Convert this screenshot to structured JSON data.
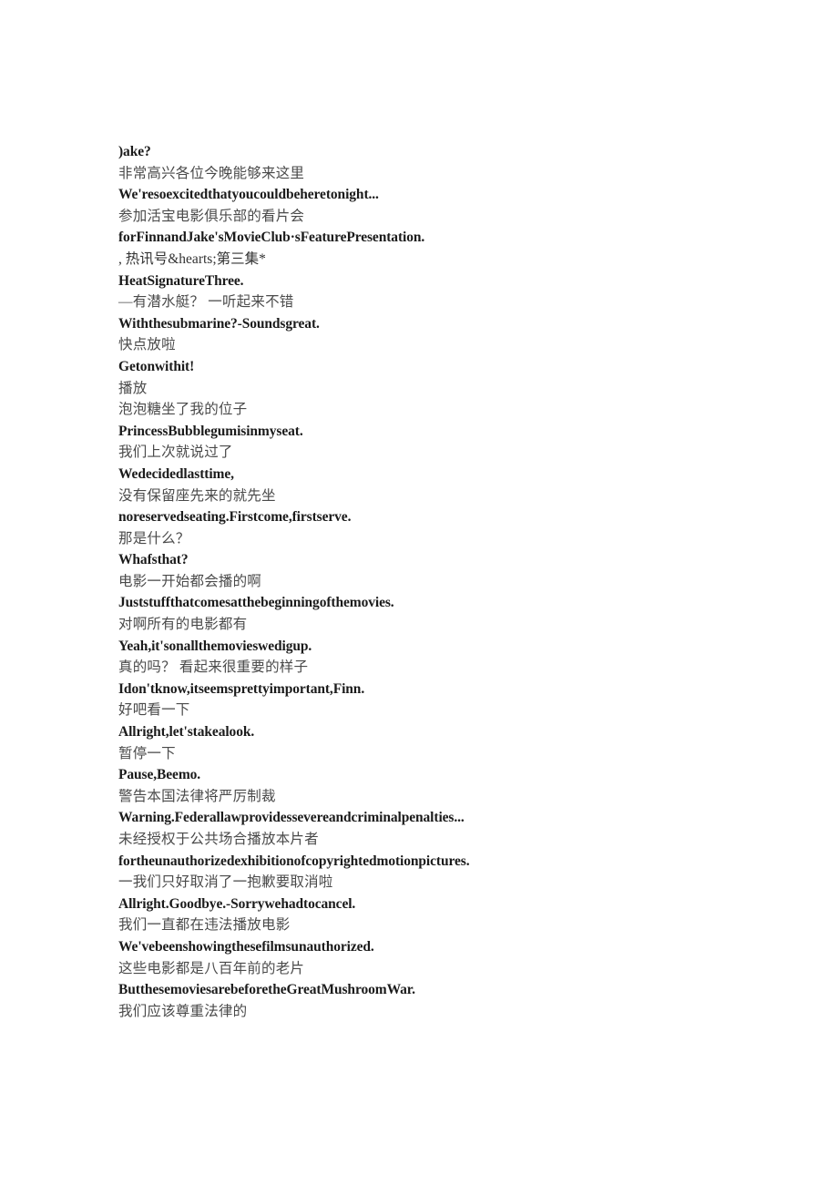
{
  "document": {
    "background_color": "#ffffff",
    "text_color_primary": "#1b1b1b",
    "text_color_secondary": "#4a4a4a",
    "lines": [
      {
        "text": ")ake?",
        "lang": "en"
      },
      {
        "text": "非常高兴各位今晚能够来这里",
        "lang": "zh"
      },
      {
        "text": "We'resoexcitedthatyoucouldbeheretonight...",
        "lang": "en"
      },
      {
        "text": "参加活宝电影俱乐部的看片会",
        "lang": "zh"
      },
      {
        "text": "forFinnandJake'sMovieClub·sFeaturePresentation.",
        "lang": "en"
      },
      {
        "text": ", 热讯号&hearts;第三集*",
        "lang": "mixed"
      },
      {
        "text": "HeatSignatureThree.",
        "lang": "en"
      },
      {
        "text": "—有潜水艇？ 一听起来不错",
        "lang": "zh"
      },
      {
        "text": "Withthesubmarine?-Soundsgreat.",
        "lang": "en"
      },
      {
        "text": "快点放啦",
        "lang": "zh"
      },
      {
        "text": "Getonwithit!",
        "lang": "en"
      },
      {
        "text": "播放",
        "lang": "zh"
      },
      {
        "text": "泡泡糖坐了我的位子",
        "lang": "zh"
      },
      {
        "text": "PrincessBubblegumisinmyseat.",
        "lang": "en"
      },
      {
        "text": "我们上次就说过了",
        "lang": "zh"
      },
      {
        "text": "Wedecidedlasttime,",
        "lang": "en"
      },
      {
        "text": "没有保留座先来的就先坐",
        "lang": "zh"
      },
      {
        "text": "noreservedseating.Firstcome,firstserve.",
        "lang": "en"
      },
      {
        "text": "那是什么？",
        "lang": "zh"
      },
      {
        "text": "Whafsthat?",
        "lang": "en"
      },
      {
        "text": "电影一开始都会播的啊",
        "lang": "zh"
      },
      {
        "text": "Juststuffthatcomesatthebeginningofthemovies.",
        "lang": "en"
      },
      {
        "text": "对啊所有的电影都有",
        "lang": "zh"
      },
      {
        "text": "Yeah,it'sonallthemovieswedigup.",
        "lang": "en"
      },
      {
        "text": "真的吗？ 看起来很重要的样子",
        "lang": "zh"
      },
      {
        "text": "Idon'tknow,itseemsprettyimportant,Finn.",
        "lang": "en"
      },
      {
        "text": "好吧看一下",
        "lang": "zh"
      },
      {
        "text": "Allright,let'stakealook.",
        "lang": "en"
      },
      {
        "text": "暂停一下",
        "lang": "zh"
      },
      {
        "text": "Pause,Beemo.",
        "lang": "en"
      },
      {
        "text": "警告本国法律将严厉制裁",
        "lang": "zh"
      },
      {
        "text": "Warning.Federallawprovidessevereandcriminalpenalties...",
        "lang": "en"
      },
      {
        "text": "未经授权于公共场合播放本片者",
        "lang": "zh"
      },
      {
        "text": "fortheunauthorizedexhibitionofcopyrightedmotionpictures.",
        "lang": "en"
      },
      {
        "text": "一我们只好取消了一抱歉要取消啦",
        "lang": "zh"
      },
      {
        "text": "Allright.Goodbye.-Sorrywehadtocancel.",
        "lang": "en"
      },
      {
        "text": "我们一直都在违法播放电影",
        "lang": "zh"
      },
      {
        "text": "We'vebeenshowingthesefilmsunauthorized.",
        "lang": "en"
      },
      {
        "text": "这些电影都是八百年前的老片",
        "lang": "zh"
      },
      {
        "text": "ButthesemoviesarebeforetheGreatMushroomWar.",
        "lang": "en"
      },
      {
        "text": "我们应该尊重法律的",
        "lang": "zh"
      }
    ]
  }
}
